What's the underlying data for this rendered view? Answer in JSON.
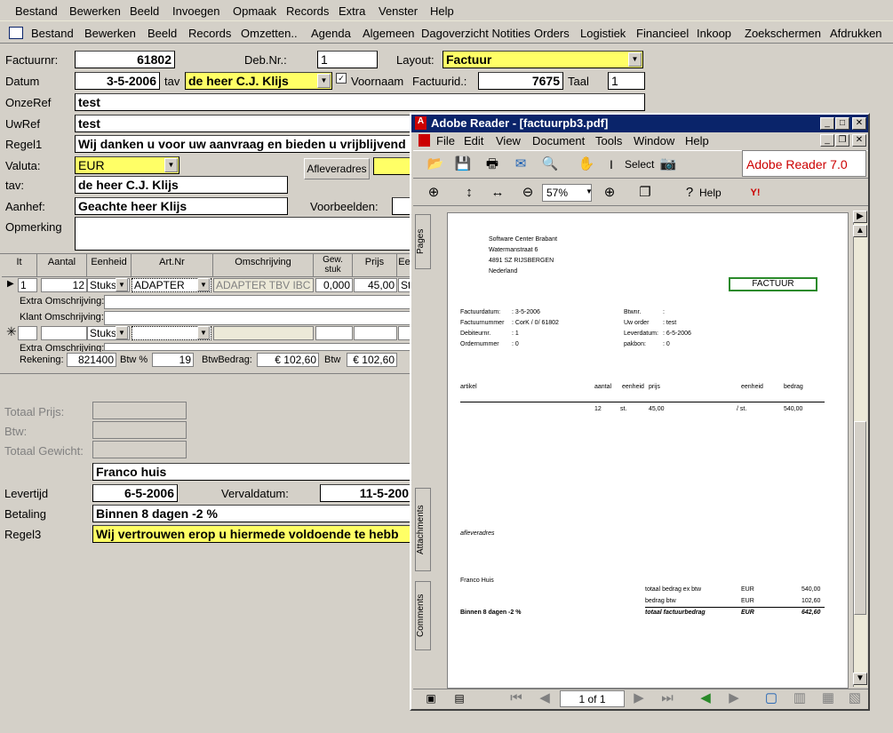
{
  "menubar": [
    "Bestand",
    "Bewerken",
    "Beeld",
    "Invoegen",
    "Opmaak",
    "Records",
    "Extra",
    "Venster",
    "Help"
  ],
  "menubar2": [
    "Bestand",
    "Bewerken",
    "Beeld",
    "Records",
    "Omzetten..",
    "Agenda",
    "Algemeen",
    "Dagoverzicht Notities",
    "Orders",
    "Logistiek",
    "Financieel",
    "Inkoop",
    "Zoekschermen",
    "Afdrukken"
  ],
  "form": {
    "factuurnr_label": "Factuurnr:",
    "factuurnr": "61802",
    "debnr_label": "Deb.Nr.:",
    "debnr": "1",
    "layout_label": "Layout:",
    "layout": "Factuur",
    "datum_label": "Datum",
    "datum": "3-5-2006",
    "tav_label": "tav",
    "tav_value": "de heer C.J. Klijs",
    "voornaam_label": "Voornaam",
    "factuurid_label": "Factuurid.:",
    "factuurid": "7675",
    "taal_label": "Taal",
    "taal": "1",
    "onzeref_label": "OnzeRef",
    "onzeref": "test",
    "uwref_label": "UwRef",
    "uwref": "test",
    "regel1_label": "Regel1",
    "regel1": "Wij danken u voor uw aanvraag en bieden u vrijblijvend",
    "valuta_label": "Valuta:",
    "valuta": "EUR",
    "afleveradres_button": "Afleveradres",
    "tav2_label": "tav:",
    "tav2": "de heer C.J. Klijs",
    "aanhef_label": "Aanhef:",
    "aanhef": "Geachte heer Klijs",
    "voorbeelden_label": "Voorbeelden:",
    "opmerking_label": "Opmerking"
  },
  "grid": {
    "headers": [
      "It",
      "Aantal",
      "Eenheid",
      "Art.Nr",
      "Omschrijving",
      "Gew. stuk",
      "Prijs",
      "Ee"
    ],
    "row": {
      "it": "1",
      "aantal": "12",
      "eenheid": "Stuks",
      "artnr": "ADAPTER",
      "omschrijving": "ADAPTER TBV IBC KF",
      "gew": "0,000",
      "prijs": "45,00",
      "ee": "St"
    },
    "extra_omschrijving_label": "Extra Omschrijving:",
    "klant_omschrijving_label": "Klant Omschrijving:",
    "new_row_eenheid": "Stuks",
    "extra_omschrijving_label2": "Extra Omschrijving:"
  },
  "footer_row": {
    "rekening_label": "Rekening:",
    "rekening": "821400",
    "btwpct_label": "Btw %",
    "btwpct": "19",
    "btwbedrag_label": "BtwBedrag:",
    "btwbedrag": "€ 102,60",
    "btw_label": "Btw",
    "btw": "€ 102,60"
  },
  "totals": {
    "totaal_prijs": "Totaal Prijs:",
    "btw": "Btw:",
    "totaal_gewicht": "Totaal Gewicht:"
  },
  "bottom": {
    "franco": "Franco huis",
    "levertijd_label": "Levertijd",
    "levertijd": "6-5-2006",
    "vervaldatum_label": "Vervaldatum:",
    "vervaldatum": "11-5-200",
    "betaling_label": "Betaling",
    "betaling": "Binnen 8 dagen -2 %",
    "regel3_label": "Regel3",
    "regel3": "Wij vertrouwen erop u hiermede voldoende te hebb"
  },
  "adobe": {
    "title": "Adobe Reader - [factuurpb3.pdf]",
    "menu": [
      "File",
      "Edit",
      "View",
      "Document",
      "Tools",
      "Window",
      "Help"
    ],
    "select_label": "Select",
    "zoom": "57%",
    "help_label": "Help",
    "logo": "Adobe Reader 7.0",
    "tabs": [
      "Pages",
      "Attachments",
      "Comments"
    ],
    "page_nav": "1 of 1",
    "pdf": {
      "company": [
        "Software Center Brabant",
        "Watermanstraat 6",
        "4891 SZ RIJSBERGEN",
        "Nederland"
      ],
      "doc_title": "FACTUUR",
      "left_info": [
        [
          "Factuurdatum:",
          ":  3-5-2006"
        ],
        [
          "Factuurnummer",
          ":  CorK  /  0/  61802"
        ],
        [
          "Debiteurnr.",
          ":  1"
        ],
        [
          "Ordernummer",
          ":  0"
        ]
      ],
      "right_info": [
        [
          "Btwnr.",
          ":"
        ],
        [
          "Uw order",
          ":  test"
        ],
        [
          "Leverdatum:",
          ":  6-5-2006"
        ],
        [
          "pakbon:",
          ":  0"
        ]
      ],
      "table_headers": [
        "artikel",
        "aantal",
        "eenheid",
        "prijs",
        "eenheid",
        "bedrag"
      ],
      "table_row": [
        "12",
        "st.",
        "45,00",
        "/  st.",
        "540,00"
      ],
      "afleveradres": "afleveradres",
      "franco": "Franco Huis",
      "betaling": "Binnen 8 dagen -2 %",
      "sums": [
        [
          "totaal bedrag ex btw",
          "EUR",
          "540,00"
        ],
        [
          "bedrag btw",
          "EUR",
          "102,60"
        ],
        [
          "totaal factuurbedrag",
          "EUR",
          "642,60"
        ]
      ]
    }
  }
}
